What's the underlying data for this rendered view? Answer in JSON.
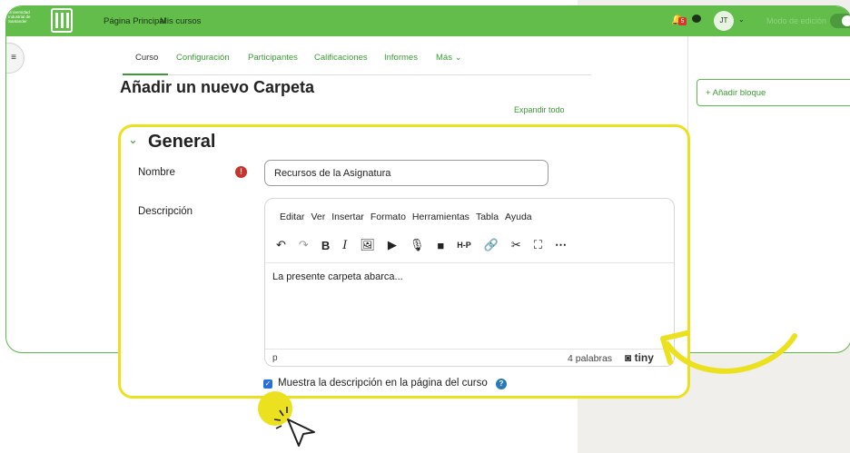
{
  "topbar": {
    "logo_text": "Universidad Industrial de Santander",
    "nav": [
      "Página Principal",
      "Mis cursos"
    ],
    "notification_count": "5",
    "avatar_initials": "JT",
    "edit_mode_label": "Modo de edición"
  },
  "tabs": [
    "Curso",
    "Configuración",
    "Participantes",
    "Calificaciones",
    "Informes",
    "Más ⌄"
  ],
  "page_title": "Añadir un nuevo Carpeta",
  "expand_all": "Expandir todo",
  "add_block": "+  Añadir bloque",
  "section": {
    "title": "General",
    "name_label": "Nombre",
    "name_value": "Recursos de la Asignatura",
    "description_label": "Descripción"
  },
  "editor": {
    "menu": [
      "Editar",
      "Ver",
      "Insertar",
      "Formato",
      "Herramientas",
      "Tabla",
      "Ayuda"
    ],
    "content": "La presente carpeta abarca...",
    "status_path": "p",
    "word_count": "4 palabras",
    "brand": "tiny"
  },
  "show_description": {
    "label": "Muestra la descripción en la página del curso",
    "checked": true
  },
  "colors": {
    "brand_green": "#62bd4b",
    "highlight_yellow": "#ece11f",
    "required_red": "#c8332d"
  }
}
